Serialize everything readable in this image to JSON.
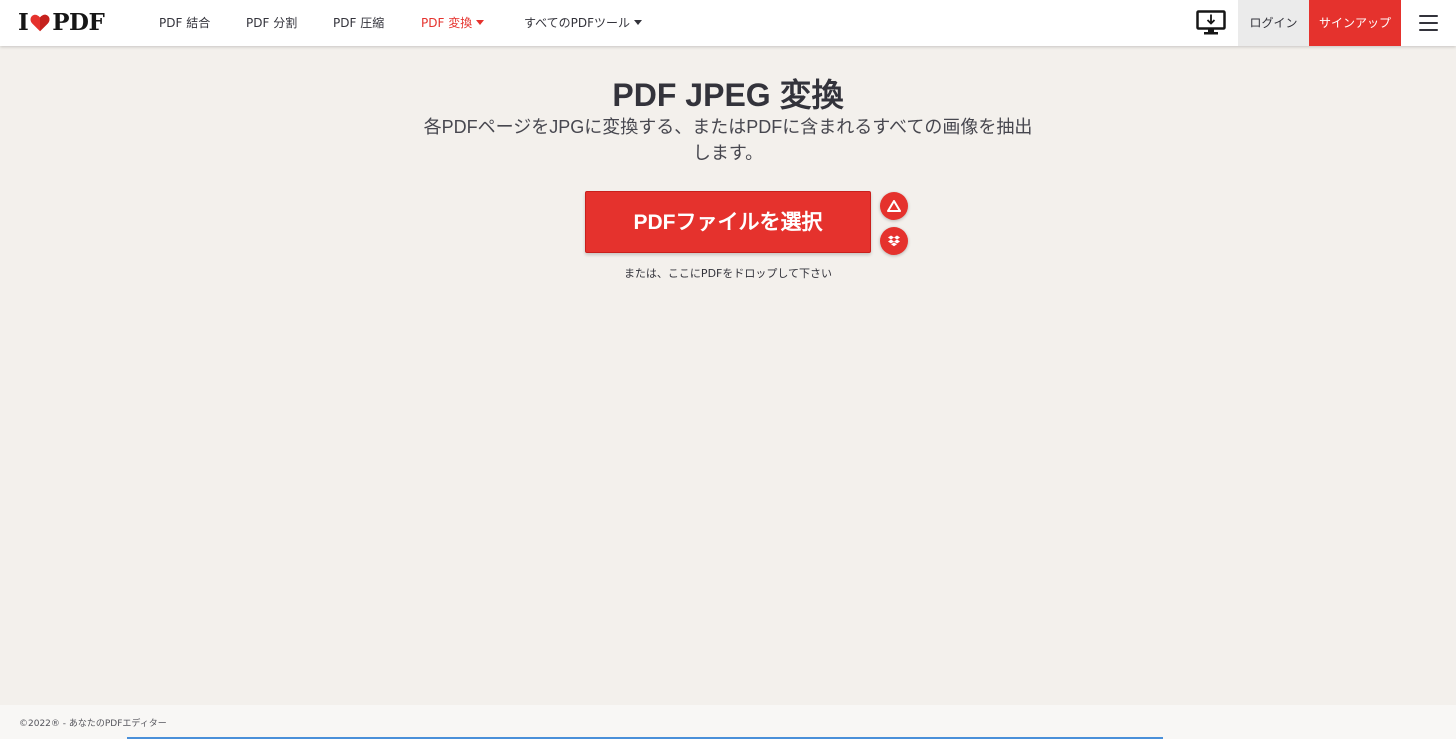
{
  "header": {
    "logo": {
      "pre": "I",
      "post": "PDF"
    },
    "nav": [
      {
        "label": "PDF 結合",
        "active": false
      },
      {
        "label": "PDF 分割",
        "active": false
      },
      {
        "label": "PDF 圧縮",
        "active": false
      },
      {
        "label": "PDF 変換",
        "active": true,
        "dropdown": true
      },
      {
        "label": "すべてのPDFツール",
        "active": false,
        "dropdown": true
      }
    ],
    "login_label": "ログイン",
    "signup_label": "サインアップ"
  },
  "main": {
    "title": "PDF JPEG 変換",
    "subtitle": "各PDFページをJPGに変換する、またはPDFに含まれるすべての画像を抽出します。",
    "select_button_label": "PDFファイルを選択",
    "cloud_buttons": [
      {
        "icon": "google-drive-icon"
      },
      {
        "icon": "dropbox-icon"
      }
    ],
    "drop_hint": "または、ここにPDFをドロップして下さい"
  },
  "footer": {
    "text": "©2022® - あなたのPDFエディター"
  },
  "colors": {
    "brand_red": "#e5322d",
    "page_bg": "#f3f0ec",
    "text": "#33333b"
  }
}
